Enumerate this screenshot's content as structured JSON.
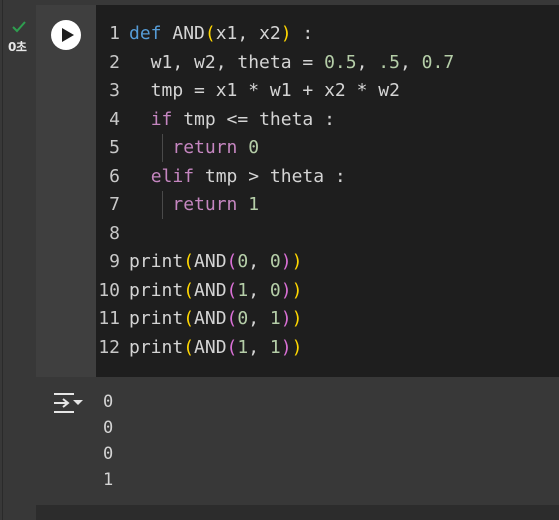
{
  "cell": {
    "status": "success",
    "exec_time": "0초",
    "run_icon": "play-icon",
    "check_icon": "check-icon"
  },
  "code": {
    "lines": [
      {
        "n": "1",
        "tokens": [
          [
            "kw-def",
            "def"
          ],
          [
            "code-text",
            " AND"
          ],
          [
            "par1",
            "("
          ],
          [
            "code-text",
            "x1, x2"
          ],
          [
            "par1",
            ")"
          ],
          [
            "code-text",
            " :"
          ]
        ]
      },
      {
        "n": "2",
        "tokens": [
          [
            "code-text",
            "  w1, w2, theta = "
          ],
          [
            "num",
            "0.5"
          ],
          [
            "code-text",
            ", "
          ],
          [
            "num",
            ".5"
          ],
          [
            "code-text",
            ", "
          ],
          [
            "num",
            "0.7"
          ]
        ]
      },
      {
        "n": "3",
        "tokens": [
          [
            "code-text",
            "  tmp = x1 * w1 + x2 * w2"
          ]
        ]
      },
      {
        "n": "4",
        "tokens": [
          [
            "code-text",
            "  "
          ],
          [
            "kw",
            "if"
          ],
          [
            "code-text",
            " tmp <= theta :"
          ]
        ]
      },
      {
        "n": "5",
        "tokens": [
          [
            "code-text",
            "    "
          ],
          [
            "kw",
            "return"
          ],
          [
            "code-text",
            " "
          ],
          [
            "num",
            "0"
          ]
        ]
      },
      {
        "n": "6",
        "tokens": [
          [
            "code-text",
            "  "
          ],
          [
            "kw",
            "elif"
          ],
          [
            "code-text",
            " tmp > theta :"
          ]
        ]
      },
      {
        "n": "7",
        "tokens": [
          [
            "code-text",
            "    "
          ],
          [
            "kw",
            "return"
          ],
          [
            "code-text",
            " "
          ],
          [
            "num",
            "1"
          ]
        ]
      },
      {
        "n": "8",
        "tokens": []
      },
      {
        "n": "9",
        "tokens": [
          [
            "fn",
            "print"
          ],
          [
            "par1",
            "("
          ],
          [
            "fn",
            "AND"
          ],
          [
            "par2",
            "("
          ],
          [
            "num",
            "0"
          ],
          [
            "code-text",
            ", "
          ],
          [
            "num",
            "0"
          ],
          [
            "par2",
            ")"
          ],
          [
            "par1",
            ")"
          ]
        ]
      },
      {
        "n": "10",
        "tokens": [
          [
            "fn",
            "print"
          ],
          [
            "par1",
            "("
          ],
          [
            "fn",
            "AND"
          ],
          [
            "par2",
            "("
          ],
          [
            "num",
            "1"
          ],
          [
            "code-text",
            ", "
          ],
          [
            "num",
            "0"
          ],
          [
            "par2",
            ")"
          ],
          [
            "par1",
            ")"
          ]
        ]
      },
      {
        "n": "11",
        "tokens": [
          [
            "fn",
            "print"
          ],
          [
            "par1",
            "("
          ],
          [
            "fn",
            "AND"
          ],
          [
            "par2",
            "("
          ],
          [
            "num",
            "0"
          ],
          [
            "code-text",
            ", "
          ],
          [
            "num",
            "1"
          ],
          [
            "par2",
            ")"
          ],
          [
            "par1",
            ")"
          ]
        ]
      },
      {
        "n": "12",
        "tokens": [
          [
            "fn",
            "print"
          ],
          [
            "par1",
            "("
          ],
          [
            "fn",
            "AND"
          ],
          [
            "par2",
            "("
          ],
          [
            "num",
            "1"
          ],
          [
            "code-text",
            ", "
          ],
          [
            "num",
            "1"
          ],
          [
            "par2",
            ")"
          ],
          [
            "par1",
            ")"
          ]
        ]
      }
    ]
  },
  "output": {
    "icon": "output-toggle-icon",
    "lines": [
      "0",
      "0",
      "0",
      "1"
    ]
  },
  "colors": {
    "background": "#383838",
    "editor": "#1e1e1e",
    "keyword": "#c586c0",
    "def_keyword": "#569cd6",
    "number": "#b5cea8",
    "bracket_outer": "#ffd700",
    "bracket_inner": "#da70d6",
    "success": "#2e9e4f"
  }
}
